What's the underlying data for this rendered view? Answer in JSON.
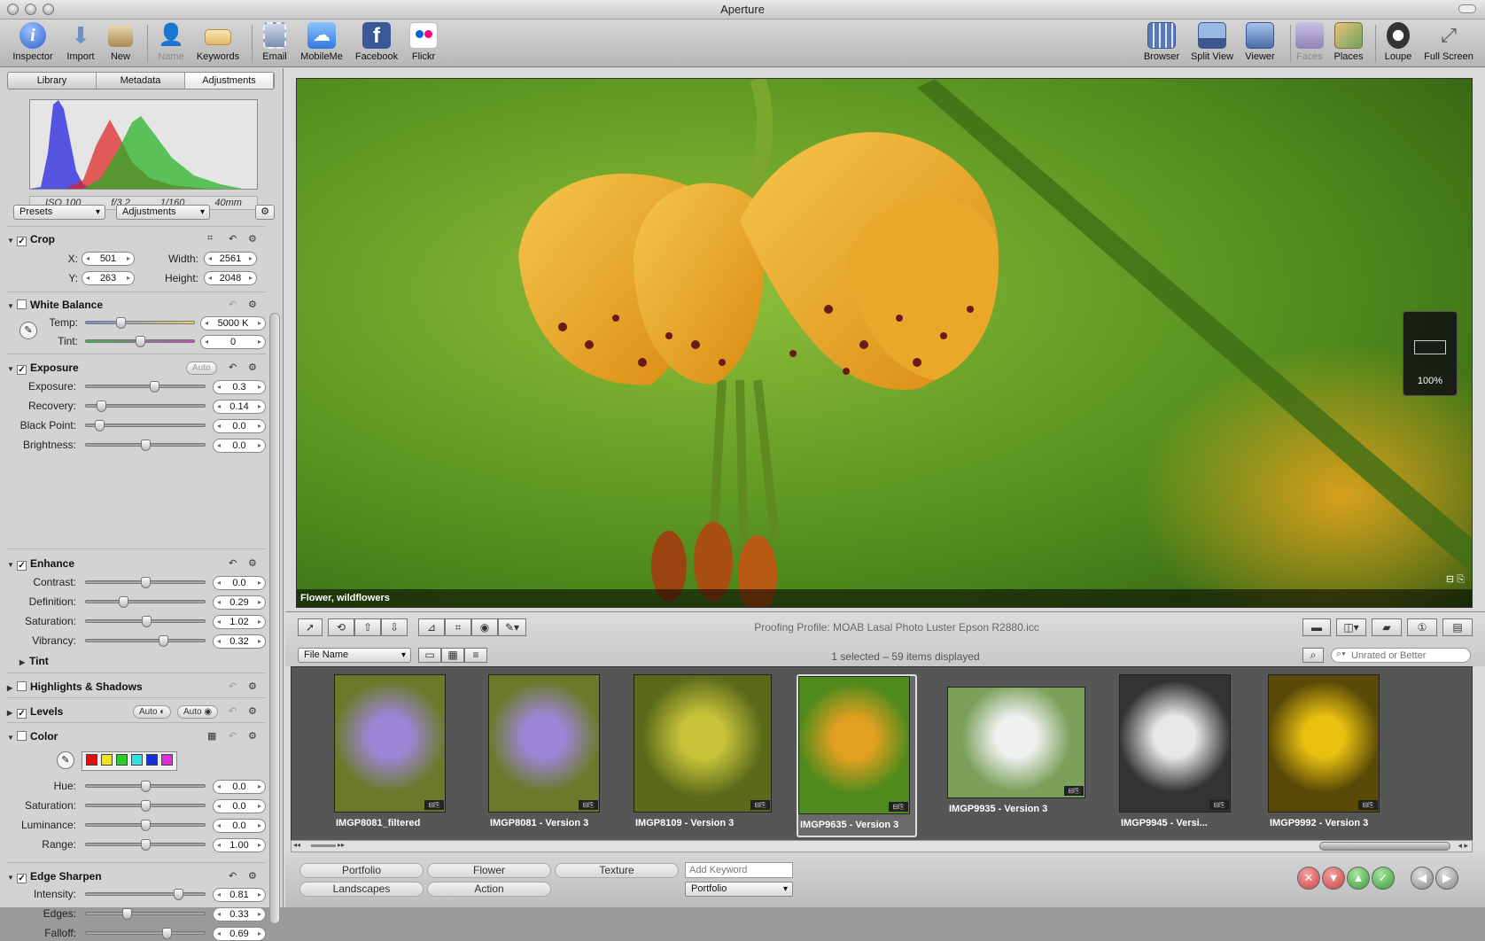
{
  "window": {
    "title": "Aperture"
  },
  "toolbar": {
    "left": [
      {
        "label": "Inspector",
        "icon": "info-icon",
        "color": "#3a73d6"
      },
      {
        "label": "Import",
        "icon": "import-arrow-icon",
        "color": "#6f8ec8"
      },
      {
        "label": "New",
        "icon": "new-folder-icon",
        "color": "#b79c6b"
      },
      {
        "label": "Name",
        "icon": "name-person-icon",
        "color": "#8a8a8a"
      },
      {
        "label": "Keywords",
        "icon": "keyword-tag-icon",
        "color": "#e3c27a"
      },
      {
        "label": "Email",
        "icon": "email-stamp-icon",
        "color": "#7c8fb0"
      },
      {
        "label": "MobileMe",
        "icon": "mobileme-cloud-icon",
        "color": "#4a90e2"
      },
      {
        "label": "Facebook",
        "icon": "facebook-icon",
        "color": "#3b5998"
      },
      {
        "label": "Flickr",
        "icon": "flickr-icon",
        "color": "#ffffff"
      }
    ],
    "right": [
      {
        "label": "Browser",
        "icon": "browser-grid-icon",
        "color": "#5a79b8"
      },
      {
        "label": "Split View",
        "icon": "split-view-icon",
        "color": "#5a79b8"
      },
      {
        "label": "Viewer",
        "icon": "viewer-icon",
        "color": "#5a79b8"
      },
      {
        "label": "Faces",
        "icon": "faces-icon",
        "color": "#9a8fc0"
      },
      {
        "label": "Places",
        "icon": "places-map-icon",
        "color": "#c98c5a"
      },
      {
        "label": "Loupe",
        "icon": "loupe-icon",
        "color": "#333333"
      },
      {
        "label": "Full Screen",
        "icon": "full-screen-icon",
        "color": "#666666"
      }
    ]
  },
  "inspector": {
    "tabs": [
      "Library",
      "Metadata",
      "Adjustments"
    ],
    "exif": [
      "ISO 100",
      "f/3.2",
      "1/160",
      "40mm"
    ],
    "presets": "Presets",
    "adjustments": "Adjustments",
    "crop": {
      "title": "Crop",
      "x_label": "X:",
      "x": "501",
      "y_label": "Y:",
      "y": "263",
      "w_label": "Width:",
      "w": "2561",
      "h_label": "Height:",
      "h": "2048"
    },
    "wb": {
      "title": "White Balance",
      "temp_label": "Temp:",
      "temp": "5000 K",
      "tint_label": "Tint:",
      "tint": "0"
    },
    "exposure": {
      "title": "Exposure",
      "auto": "Auto",
      "rows": [
        {
          "label": "Exposure:",
          "value": "0.3",
          "level": 0.58
        },
        {
          "label": "Recovery:",
          "value": "0.14",
          "level": 0.1
        },
        {
          "label": "Black Point:",
          "value": "0.0",
          "level": 0.08
        },
        {
          "label": "Brightness:",
          "value": "0.0",
          "level": 0.5
        }
      ]
    },
    "enhance": {
      "title": "Enhance",
      "tint": "Tint",
      "rows": [
        {
          "label": "Contrast:",
          "value": "0.0",
          "level": 0.5
        },
        {
          "label": "Definition:",
          "value": "0.29",
          "level": 0.3
        },
        {
          "label": "Saturation:",
          "value": "1.02",
          "level": 0.51
        },
        {
          "label": "Vibrancy:",
          "value": "0.32",
          "level": 0.66
        }
      ]
    },
    "highlights": {
      "title": "Highlights & Shadows"
    },
    "levels": {
      "title": "Levels",
      "auto1": "Auto",
      "auto2": "Auto"
    },
    "color": {
      "title": "Color",
      "swatches": [
        "#e01010",
        "#f2e21a",
        "#2ccc2c",
        "#2ee0e0",
        "#1430d8",
        "#e02ce0"
      ],
      "rows": [
        {
          "label": "Hue:",
          "value": "0.0",
          "level": 0.5
        },
        {
          "label": "Saturation:",
          "value": "0.0",
          "level": 0.5
        },
        {
          "label": "Luminance:",
          "value": "0.0",
          "level": 0.5
        },
        {
          "label": "Range:",
          "value": "1.00",
          "level": 0.5
        }
      ]
    },
    "sharpen": {
      "title": "Edge Sharpen",
      "rows": [
        {
          "label": "Intensity:",
          "value": "0.81",
          "level": 0.8
        },
        {
          "label": "Edges:",
          "value": "0.33",
          "level": 0.33
        },
        {
          "label": "Falloff:",
          "value": "0.69",
          "level": 0.69
        }
      ]
    }
  },
  "viewer": {
    "caption": "Flower, wildflowers",
    "zoom": "100%"
  },
  "controls": {
    "profile": "Proofing Profile: MOAB Lasal Photo Luster Epson R2880.icc",
    "sort": "File Name",
    "status": "1 selected – 59 items displayed",
    "filter": "Unrated or Better"
  },
  "thumbs": [
    {
      "name": "IMGP8081_filtered",
      "c1": "#9b86d8",
      "c2": "#6b7a2a"
    },
    {
      "name": "IMGP8081 - Version 3",
      "c1": "#9b86d8",
      "c2": "#6b7a2a"
    },
    {
      "name": "IMGP8109 - Version 3",
      "c1": "#c7c23a",
      "c2": "#5a6a1a"
    },
    {
      "name": "IMGP9635 - Version 3",
      "c1": "#e2a020",
      "c2": "#4f8a1c"
    },
    {
      "name": "IMGP9935 - Version 3",
      "c1": "#f0f0f0",
      "c2": "#7aa05a"
    },
    {
      "name": "IMGP9945 - Versi...",
      "c1": "#e8e8e8",
      "c2": "#333333"
    },
    {
      "name": "IMGP9992 - Version 3",
      "c1": "#e8c010",
      "c2": "#5a4a08"
    }
  ],
  "keywords": {
    "buttons": [
      "Portfolio",
      "Flower",
      "Texture",
      "Landscapes",
      "Action"
    ],
    "add_placeholder": "Add Keyword",
    "set": "Portfolio"
  }
}
